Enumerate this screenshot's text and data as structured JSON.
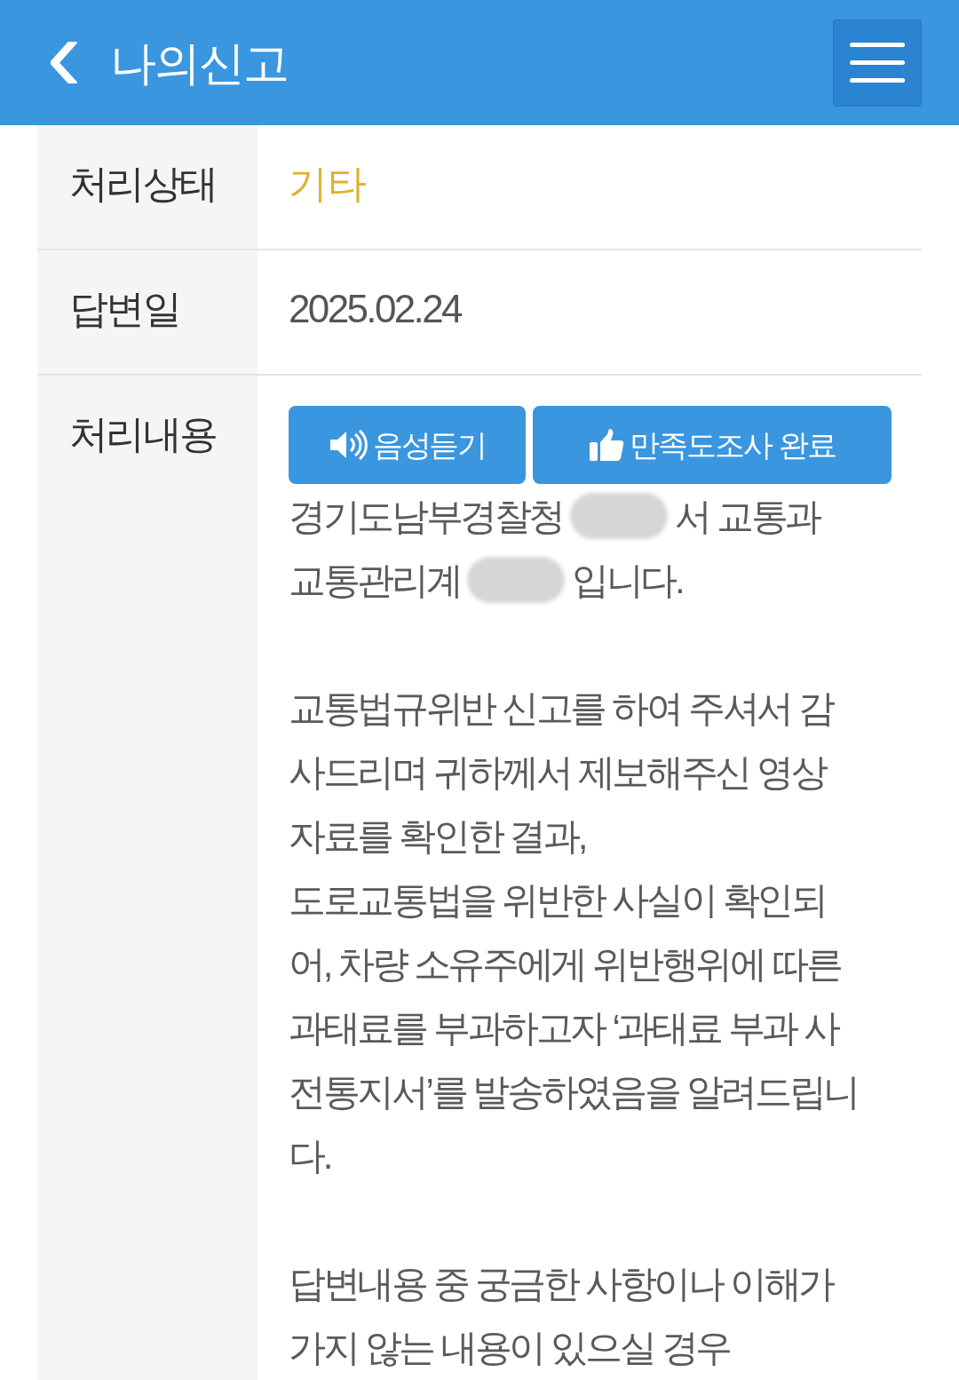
{
  "header": {
    "back": "‹",
    "title": "나의신고"
  },
  "rows": [
    {
      "kind": "status",
      "label": "처리상태",
      "value": "기타",
      "color": "#e0b030"
    },
    {
      "kind": "text",
      "label": "답변일",
      "value": "2025.02.24"
    },
    {
      "kind": "content",
      "label": "처리내용",
      "buttons": [
        {
          "kind": "listen",
          "label": "음성듣기"
        },
        {
          "kind": "survey",
          "label": "만족도조사 완료"
        }
      ],
      "lines": [
        {
          "kind": "line",
          "segments": [
            {
              "kind": "text",
              "text": "경기도남부경찰청"
            },
            {
              "kind": "redacted"
            },
            {
              "kind": "text",
              "text": "서 교통과"
            }
          ]
        },
        {
          "kind": "line",
          "segments": [
            {
              "kind": "text",
              "text": "교통관리계"
            },
            {
              "kind": "redacted"
            },
            {
              "kind": "text",
              "text": "입니다."
            }
          ]
        },
        {
          "kind": "blank"
        },
        {
          "kind": "line",
          "segments": [
            {
              "kind": "text",
              "text": "교통법규위반 신고를 하여 주셔서 감"
            }
          ]
        },
        {
          "kind": "line",
          "segments": [
            {
              "kind": "text",
              "text": "사드리며 귀하께서 제보해주신 영상"
            }
          ]
        },
        {
          "kind": "line",
          "segments": [
            {
              "kind": "text",
              "text": "자료를 확인한 결과,"
            }
          ]
        },
        {
          "kind": "line",
          "segments": [
            {
              "kind": "text",
              "text": "도로교통법을 위반한 사실이 확인되"
            }
          ]
        },
        {
          "kind": "line",
          "segments": [
            {
              "kind": "text",
              "text": "어, 차량 소유주에게 위반행위에 따른"
            }
          ]
        },
        {
          "kind": "line",
          "segments": [
            {
              "kind": "text",
              "text": "과태료를 부과하고자 ‘과태료 부과 사"
            }
          ]
        },
        {
          "kind": "line",
          "segments": [
            {
              "kind": "text",
              "text": "전통지서’를 발송하였음을 알려드립니"
            }
          ]
        },
        {
          "kind": "line",
          "segments": [
            {
              "kind": "text",
              "text": "다."
            }
          ]
        },
        {
          "kind": "blank"
        },
        {
          "kind": "line",
          "segments": [
            {
              "kind": "text",
              "text": "답변내용 중 궁금한 사항이나 이해가"
            }
          ]
        },
        {
          "kind": "line",
          "segments": [
            {
              "kind": "text",
              "text": "가지 않는 내용이 있으실 경우"
            }
          ]
        }
      ]
    }
  ]
}
